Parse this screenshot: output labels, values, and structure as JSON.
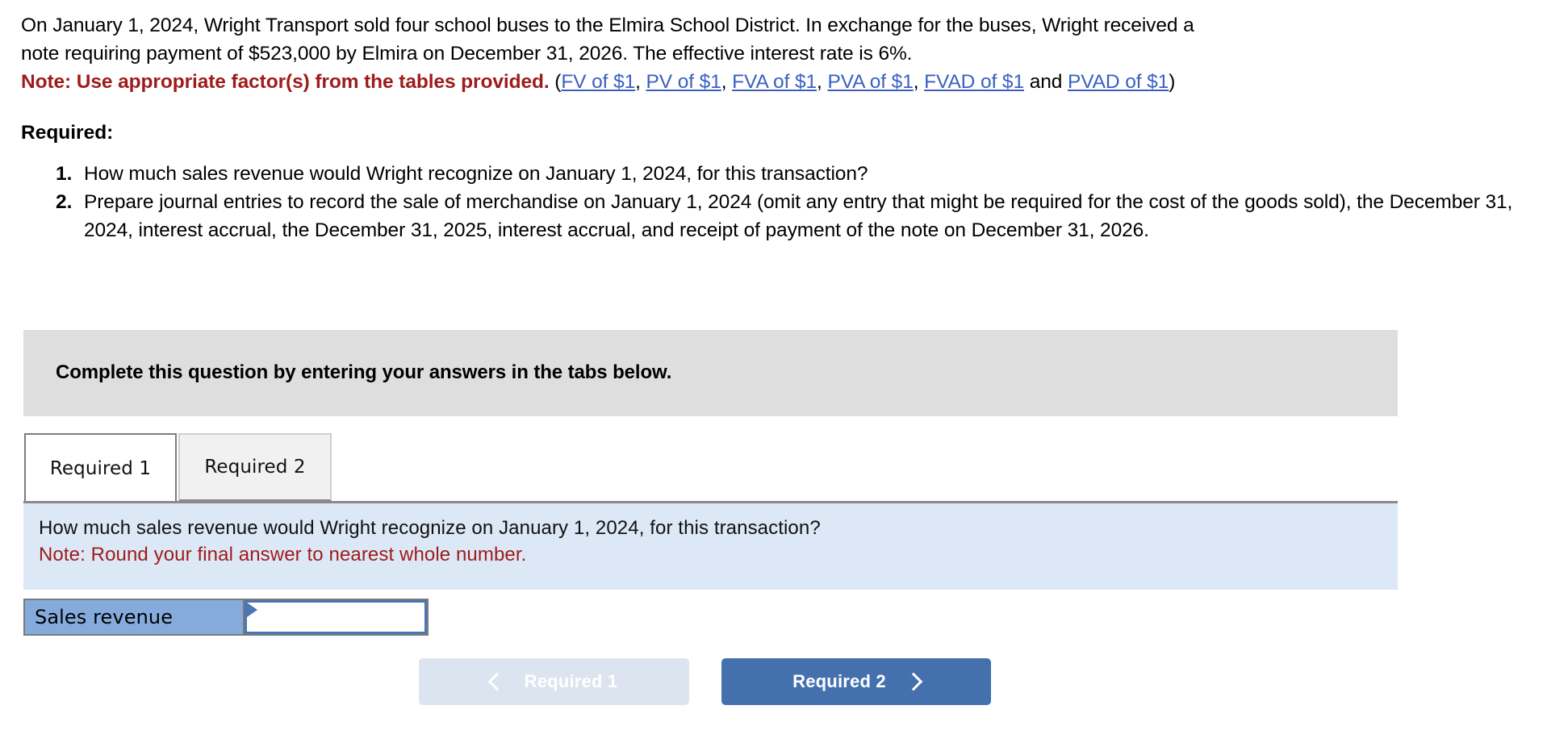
{
  "problem": {
    "paragraph_line1": "On January 1, 2024, Wright Transport sold four school buses to the Elmira School District. In exchange for the buses, Wright received a",
    "paragraph_line2": "note requiring payment of $523,000 by Elmira on December 31, 2026. The effective interest rate is 6%.",
    "note_label": "Note: Use appropriate factor(s) from the tables provided.",
    "paren_open": " (",
    "paren_close": ")",
    "and_text": " and ",
    "separator": ", ",
    "table_links": [
      "FV of $1",
      "PV of $1",
      "FVA of $1",
      "PVA of $1",
      "FVAD of $1",
      "PVAD of $1"
    ]
  },
  "required": {
    "heading": "Required:",
    "items": [
      "How much sales revenue would Wright recognize on January 1, 2024, for this transaction?",
      "Prepare journal entries to record the sale of merchandise on January 1, 2024 (omit any entry that might be required for the cost of the goods sold), the December 31, 2024, interest accrual, the December 31, 2025, interest accrual, and receipt of payment of the note on December 31, 2026."
    ]
  },
  "banner": {
    "text": "Complete this question by entering your answers in the tabs below."
  },
  "tabs": [
    {
      "label": "Required 1",
      "active": true
    },
    {
      "label": "Required 2",
      "active": false
    }
  ],
  "instruction_panel": {
    "question": "How much sales revenue would Wright recognize on January 1, 2024, for this transaction?",
    "note": "Note: Round your final answer to nearest whole number."
  },
  "answer_row": {
    "label": "Sales revenue",
    "value": "",
    "placeholder": ""
  },
  "nav": {
    "prev_label": "Required 1",
    "next_label": "Required 2",
    "prev_icon": "chevron-left-icon",
    "next_icon": "chevron-right-icon"
  },
  "colors": {
    "link": "#3b5fc0",
    "note_red": "#9e1b1b",
    "banner_gray": "#dedede",
    "panel_blue": "#dce8f6",
    "label_blue": "#85aadc",
    "button_blue": "#4471ae",
    "button_disabled": "#dce4f0",
    "input_border": "#4a76b4"
  }
}
